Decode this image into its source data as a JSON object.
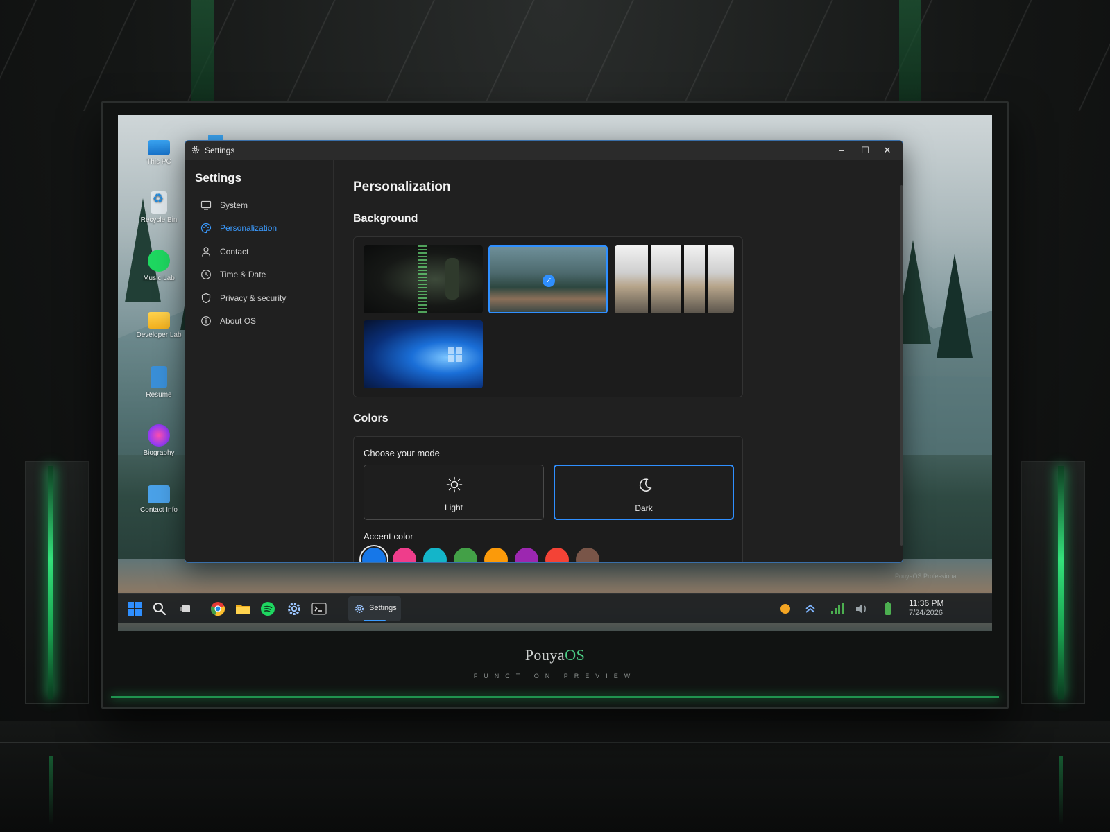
{
  "brand": {
    "name_main": "Pouya",
    "name_accent": "OS",
    "subtitle": "FUNCTION PREVIEW"
  },
  "desktop": {
    "icons": [
      {
        "label": "This PC",
        "icon": "monitor-icon"
      },
      {
        "label": "Recycle Bin",
        "icon": "recycle-bin-icon"
      },
      {
        "label": "Music Lab",
        "icon": "spotify-icon"
      },
      {
        "label": "Developer Lab",
        "icon": "folder-icon"
      },
      {
        "label": "Resume",
        "icon": "document-icon"
      },
      {
        "label": "Biography",
        "icon": "fingerprint-icon"
      },
      {
        "label": "Contact Info",
        "icon": "contact-card-icon"
      }
    ],
    "watermark": "PouyaOS Professional"
  },
  "window": {
    "title": "Settings",
    "controls": {
      "minimize": "–",
      "maximize": "☐",
      "close": "✕"
    }
  },
  "sidebar": {
    "title": "Settings",
    "items": [
      {
        "label": "System",
        "icon": "monitor-icon",
        "active": false
      },
      {
        "label": "Personalization",
        "icon": "palette-icon",
        "active": true
      },
      {
        "label": "Contact",
        "icon": "user-icon",
        "active": false
      },
      {
        "label": "Time & Date",
        "icon": "clock-icon",
        "active": false
      },
      {
        "label": "Privacy & security",
        "icon": "shield-icon",
        "active": false
      },
      {
        "label": "About OS",
        "icon": "info-icon",
        "active": false
      }
    ]
  },
  "content": {
    "page_title": "Personalization",
    "background": {
      "heading": "Background",
      "selected_index": 1,
      "options": [
        "matrix-code-wallpaper",
        "yosemite-valley-wallpaper",
        "glass-office-wallpaper",
        "windows-blue-wallpaper"
      ]
    },
    "colors": {
      "heading": "Colors",
      "mode_label": "Choose your mode",
      "modes": [
        {
          "label": "Light",
          "icon": "sun-icon",
          "selected": false
        },
        {
          "label": "Dark",
          "icon": "moon-icon",
          "selected": true
        }
      ],
      "accent_label": "Accent color",
      "accents": [
        "#1677e8",
        "#ef3d8b",
        "#14b5c9",
        "#43a047",
        "#fb9a0a",
        "#9c27b0",
        "#f44336",
        "#795548"
      ],
      "selected_accent": 0
    }
  },
  "taskbar": {
    "pinned": [
      "start-icon",
      "search-icon",
      "task-view-icon",
      "chrome-icon",
      "file-explorer-icon",
      "spotify-icon",
      "settings-icon",
      "terminal-icon"
    ],
    "running_app": {
      "label": "Settings",
      "icon": "settings-icon"
    },
    "tray": [
      "status-dot-icon",
      "chevron-up-icon",
      "signal-icon",
      "volume-icon",
      "battery-icon"
    ],
    "time": "11:36 PM",
    "date": "7/24/2026"
  },
  "colors": {
    "accent": "#3b9bff",
    "window_bg": "#202020",
    "glow_green": "#23a95a"
  }
}
